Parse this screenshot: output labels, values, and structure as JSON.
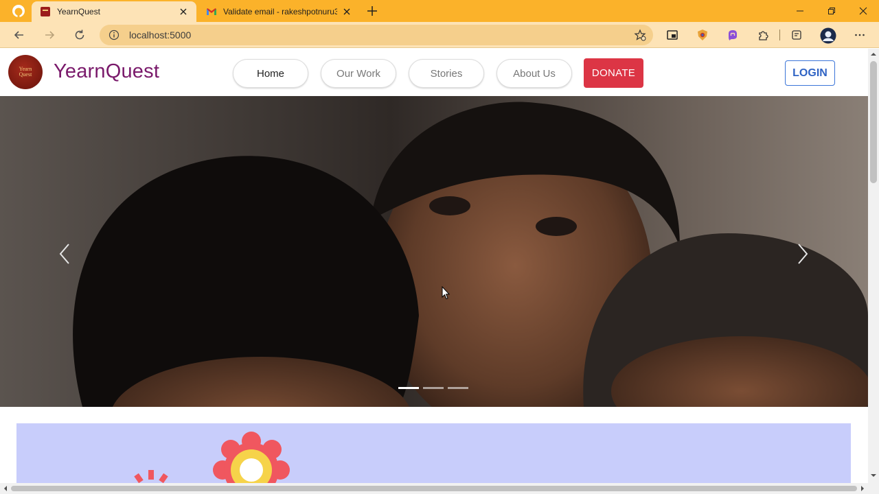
{
  "browser": {
    "tabs": [
      {
        "title": "YearnQuest",
        "active": true
      },
      {
        "title": "Validate email - rakeshpotnuru3...",
        "active": false
      }
    ],
    "url": "localhost:5000",
    "theme_color": "#fbb22a"
  },
  "site": {
    "logo_text": "Yearn Quest",
    "brand": "YearnQuest",
    "brand_color": "#7a1a6b",
    "nav": [
      {
        "label": "Home",
        "active": true
      },
      {
        "label": "Our Work",
        "active": false
      },
      {
        "label": "Stories",
        "active": false
      },
      {
        "label": "About Us",
        "active": false
      }
    ],
    "donate_label": "DONATE",
    "donate_color": "#dc3545",
    "login_label": "LOGIN",
    "login_color": "#2f63c4"
  },
  "hero": {
    "slide_count": 3,
    "active_slide": 1,
    "image_description_icon": "children-photo"
  },
  "section2": {
    "background": "#c8cdfb",
    "icon": "flower-illustration"
  }
}
